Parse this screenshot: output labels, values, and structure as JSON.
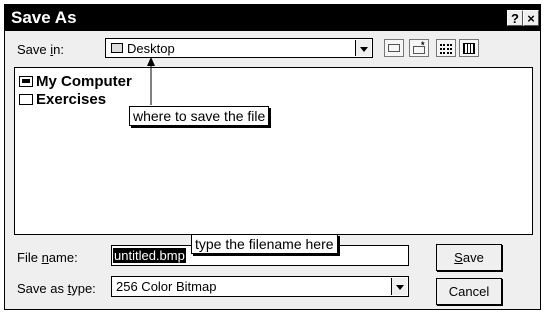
{
  "window": {
    "title": "Save As",
    "help_glyph": "?",
    "close_glyph": "×"
  },
  "save_in": {
    "label_pre": "Save ",
    "label_key": "i",
    "label_post": "n:",
    "value": "Desktop",
    "icon": "desktop-icon"
  },
  "toolbar_icons": [
    "up-folder-icon",
    "new-folder-icon",
    "list-view-icon",
    "details-view-icon"
  ],
  "files": [
    {
      "name": "My Computer",
      "icon": "computer-icon"
    },
    {
      "name": "Exercises",
      "icon": "folder-icon"
    }
  ],
  "callouts": {
    "save_location": "where to save the file",
    "filename": "type the filename here"
  },
  "file_name": {
    "label_pre": "File ",
    "label_key": "n",
    "label_post": "ame:",
    "value": "untitled.bmp"
  },
  "save_type": {
    "label_pre": "Save as ",
    "label_key": "t",
    "label_post": "ype:",
    "value": "256 Color Bitmap"
  },
  "buttons": {
    "save_key": "S",
    "save_rest": "ave",
    "cancel": "Cancel"
  }
}
